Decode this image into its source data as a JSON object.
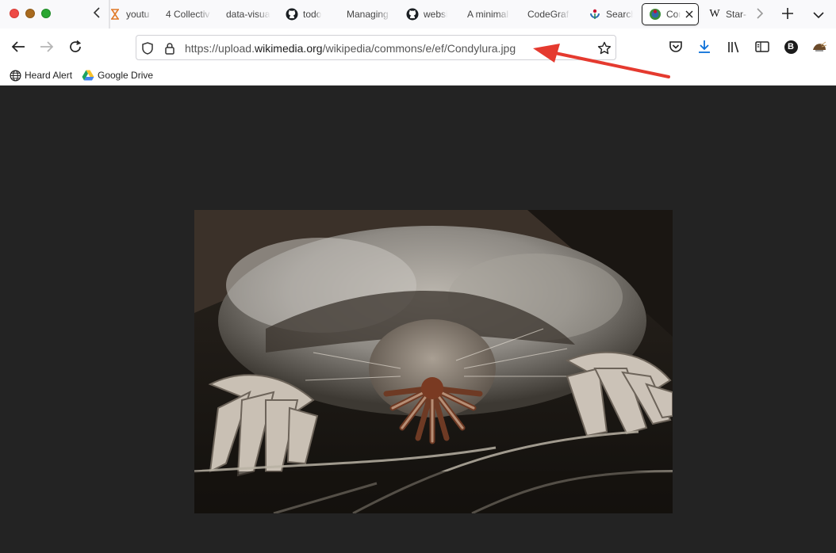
{
  "window": {
    "traffic_lights": [
      "close",
      "minimize",
      "zoom"
    ]
  },
  "tabs": [
    {
      "label": "youtu",
      "icon": "hourglass-icon"
    },
    {
      "label": "4 Collectiv",
      "icon": "none"
    },
    {
      "label": "data-visua",
      "icon": "none"
    },
    {
      "label": "todo",
      "icon": "github-icon"
    },
    {
      "label": "Managing",
      "icon": "none"
    },
    {
      "label": "websi",
      "icon": "github-icon"
    },
    {
      "label": "A minimal",
      "icon": "none"
    },
    {
      "label": "CodeGraf",
      "icon": "none"
    },
    {
      "label": "Search",
      "icon": "wikimedia-icon"
    },
    {
      "label": "Con",
      "icon": "wikimedia-commons-icon",
      "active": true
    },
    {
      "label": "Star-",
      "icon": "wikipedia-w-icon"
    }
  ],
  "navbar": {
    "url": {
      "scheme": "https://",
      "host_sub": "upload.",
      "host_domain": "wikimedia.org",
      "path": "/wikipedia/commons/e/ef/Condylura.jpg"
    }
  },
  "bookmarks": [
    {
      "label": "Heard Alert",
      "icon": "globe-icon"
    },
    {
      "label": "Google Drive",
      "icon": "google-drive-icon"
    }
  ],
  "profile": {
    "initial": "B"
  },
  "colors": {
    "viewer_bg": "#232323",
    "annotation_arrow": "#e53a2f",
    "active_tab_border": "#1f1f1f",
    "download_icon": "#0a6fd8"
  },
  "content": {
    "image_subject": "star-nosed mole photo"
  }
}
